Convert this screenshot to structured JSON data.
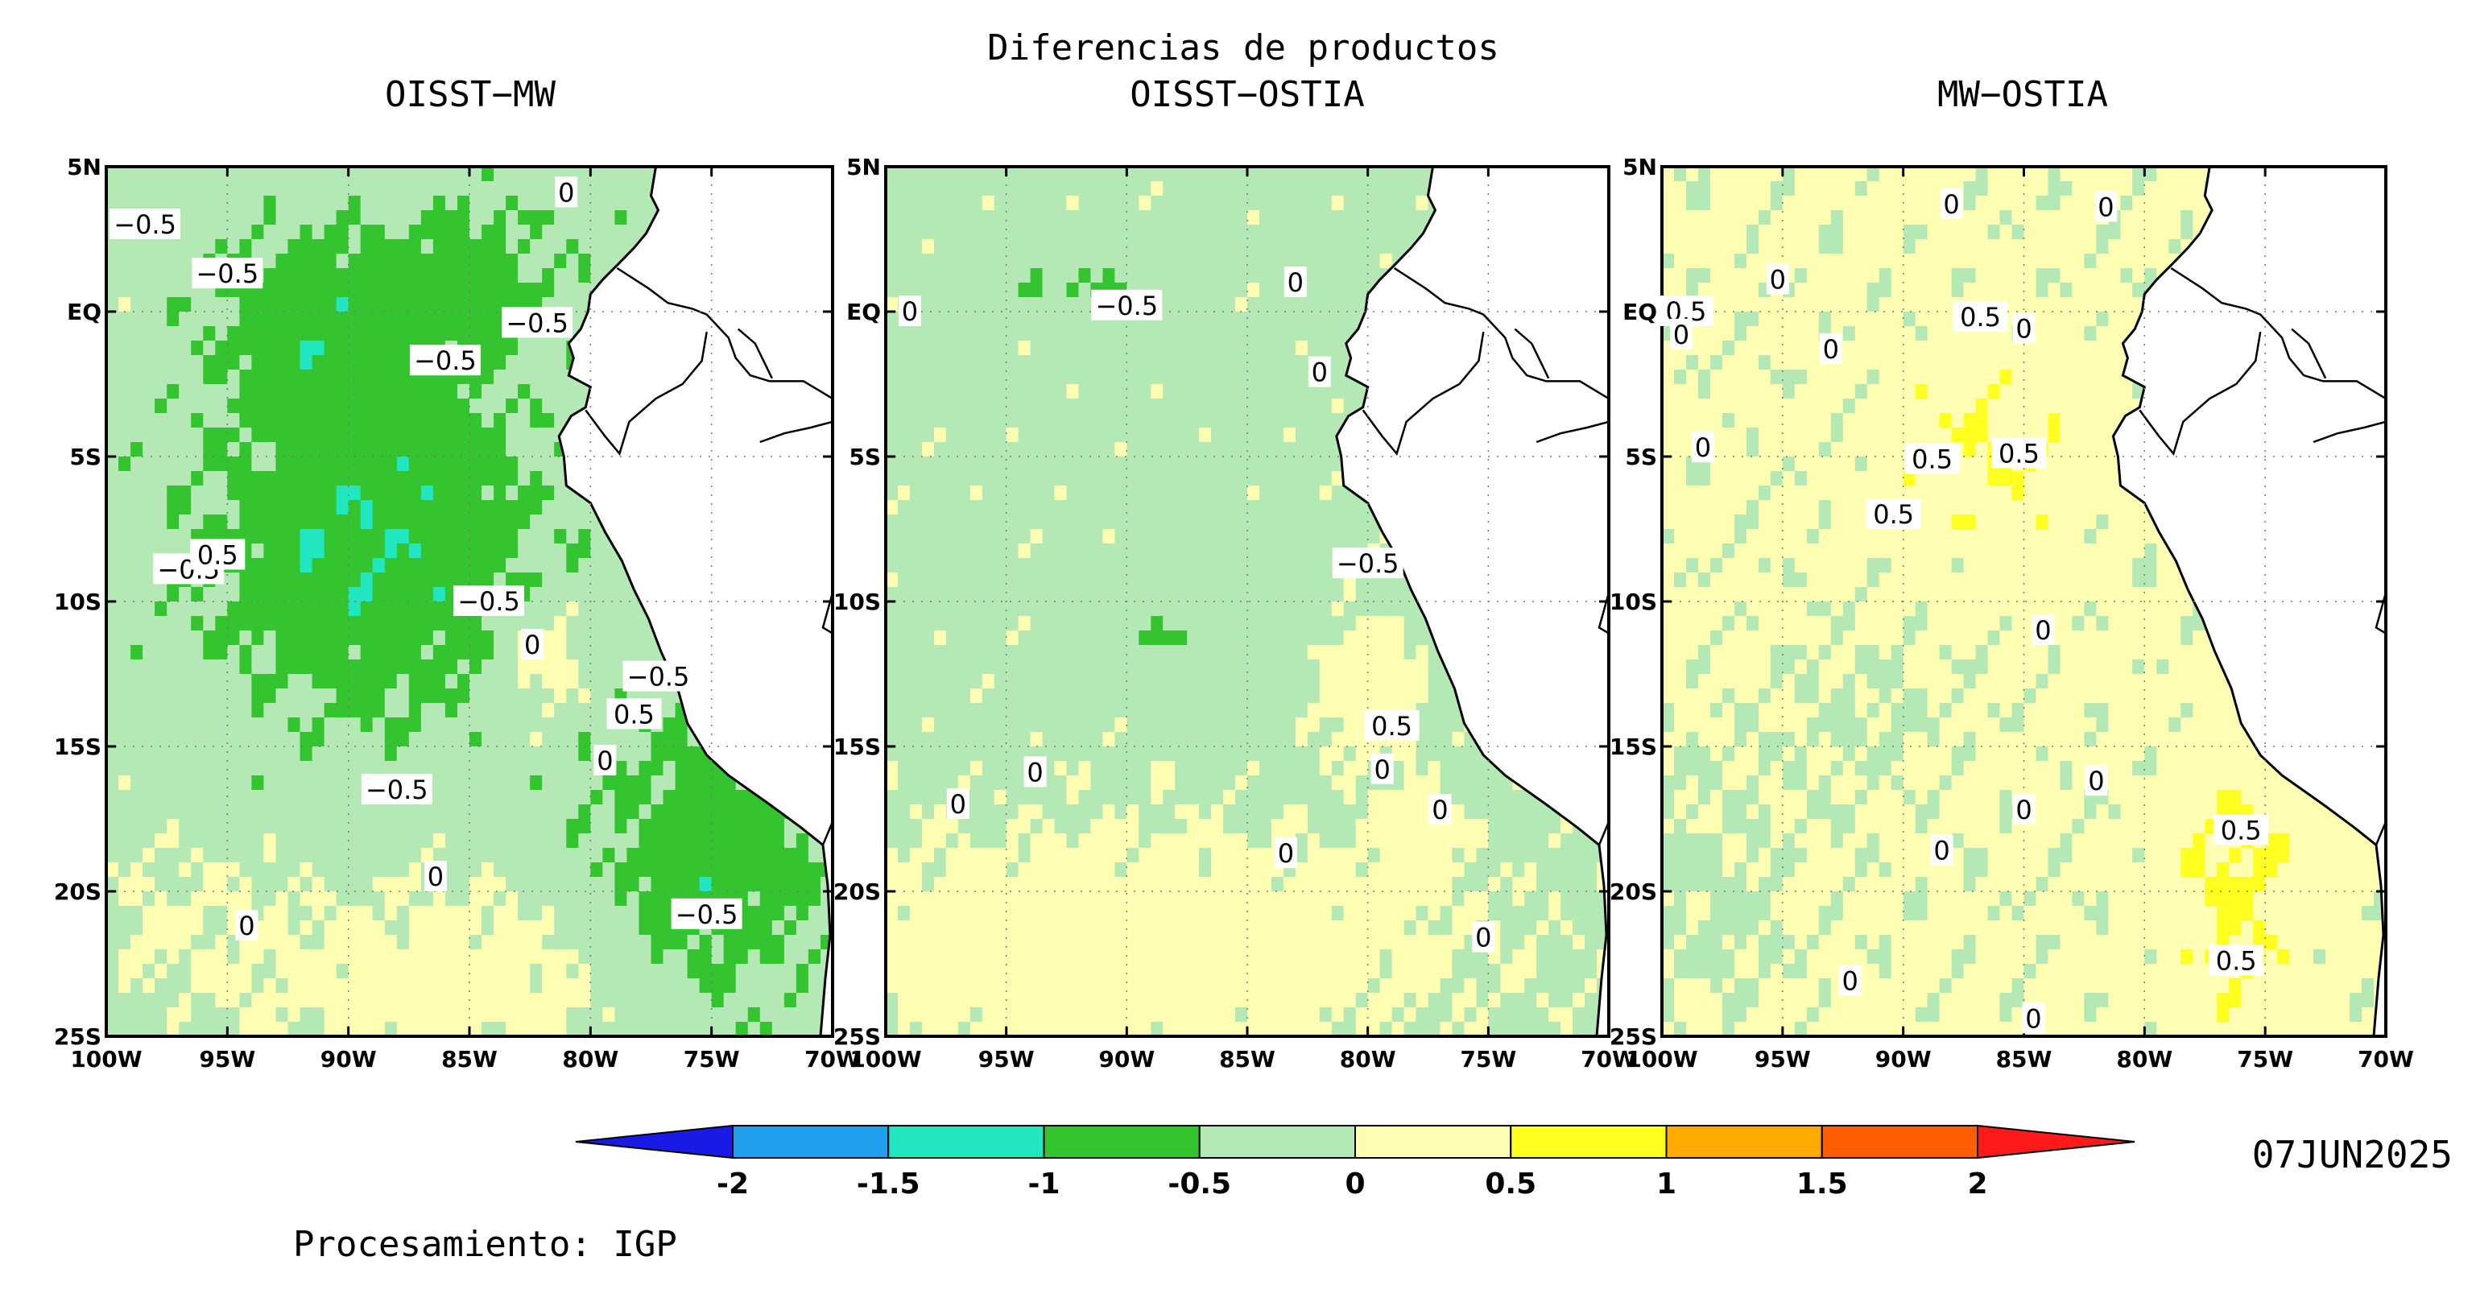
{
  "title": "Diferencias de productos",
  "date": "07JUN2025",
  "credit": "Procesamiento: IGP",
  "x_ticks": [
    "100W",
    "95W",
    "90W",
    "85W",
    "80W",
    "75W",
    "70W"
  ],
  "y_ticks": [
    "5N",
    "EQ",
    "5S",
    "10S",
    "15S",
    "20S",
    "25S"
  ],
  "colorbar": {
    "ticks": [
      "-2",
      "-1.5",
      "-1",
      "-0.5",
      "0",
      "0.5",
      "1",
      "1.5",
      "2"
    ],
    "colors": {
      "below": "#1a1ae6",
      "bins": [
        "#1f9fee",
        "#22e6c0",
        "#33c430",
        "#b4e8b4",
        "#ffffb4",
        "#ffff22",
        "#ffaa00",
        "#ff5f00"
      ],
      "above": "#ff1a1a"
    }
  },
  "colors": {
    "land": "#ffffff",
    "coast": "#000000",
    "contour": "#000000"
  },
  "panels": [
    {
      "title": "OISST−MW",
      "labels": [
        {
          "text": "−0.5",
          "lon": -98.4,
          "lat": 3.0
        },
        {
          "text": "−0.5",
          "lon": -95.0,
          "lat": 1.3
        },
        {
          "text": "−0.5",
          "lon": -82.2,
          "lat": -0.4
        },
        {
          "text": "−0.5",
          "lon": -86.0,
          "lat": -1.7
        },
        {
          "text": "0",
          "lon": -81.0,
          "lat": 4.1
        },
        {
          "text": "−0.5",
          "lon": -96.6,
          "lat": -8.9
        },
        {
          "text": "0.5",
          "lon": -95.4,
          "lat": -8.4
        },
        {
          "text": "−0.5",
          "lon": -84.2,
          "lat": -10.0
        },
        {
          "text": "0",
          "lon": -82.4,
          "lat": -11.5
        },
        {
          "text": "−0.5",
          "lon": -77.2,
          "lat": -12.6
        },
        {
          "text": "0.5",
          "lon": -78.2,
          "lat": -13.9
        },
        {
          "text": "0",
          "lon": -79.4,
          "lat": -15.5
        },
        {
          "text": "−0.5",
          "lon": -88.0,
          "lat": -16.5
        },
        {
          "text": "0",
          "lon": -86.4,
          "lat": -19.5
        },
        {
          "text": "0",
          "lon": -94.2,
          "lat": -21.2
        },
        {
          "text": "−0.5",
          "lon": -75.2,
          "lat": -20.8
        }
      ]
    },
    {
      "title": "OISST−OSTIA",
      "labels": [
        {
          "text": "−0.5",
          "lon": -90.0,
          "lat": 0.2
        },
        {
          "text": "0",
          "lon": -99.0,
          "lat": 0.0
        },
        {
          "text": "0",
          "lon": -83.0,
          "lat": 1.0
        },
        {
          "text": "0",
          "lon": -82.0,
          "lat": -2.1
        },
        {
          "text": "−0.5",
          "lon": -80.0,
          "lat": -8.7
        },
        {
          "text": "0.5",
          "lon": -79.0,
          "lat": -14.3
        },
        {
          "text": "0",
          "lon": -79.4,
          "lat": -15.8
        },
        {
          "text": "0",
          "lon": -77.0,
          "lat": -17.2
        },
        {
          "text": "0",
          "lon": -97.0,
          "lat": -17.0
        },
        {
          "text": "0",
          "lon": -93.8,
          "lat": -15.9
        },
        {
          "text": "0",
          "lon": -83.4,
          "lat": -18.7
        },
        {
          "text": "0",
          "lon": -75.2,
          "lat": -21.6
        }
      ]
    },
    {
      "title": "MW−OSTIA",
      "labels": [
        {
          "text": "0",
          "lon": -88.0,
          "lat": 3.7
        },
        {
          "text": "0",
          "lon": -81.6,
          "lat": 3.6
        },
        {
          "text": "0.5",
          "lon": -99.0,
          "lat": 0.0
        },
        {
          "text": "0",
          "lon": -99.2,
          "lat": -0.8
        },
        {
          "text": "0",
          "lon": -95.2,
          "lat": 1.1
        },
        {
          "text": "0.5",
          "lon": -86.8,
          "lat": -0.2
        },
        {
          "text": "0",
          "lon": -85.0,
          "lat": -0.6
        },
        {
          "text": "0",
          "lon": -93.0,
          "lat": -1.3
        },
        {
          "text": "0",
          "lon": -98.3,
          "lat": -4.7
        },
        {
          "text": "0.5",
          "lon": -88.8,
          "lat": -5.1
        },
        {
          "text": "0.5",
          "lon": -85.2,
          "lat": -4.9
        },
        {
          "text": "0.5",
          "lon": -90.4,
          "lat": -7.0
        },
        {
          "text": "0",
          "lon": -84.2,
          "lat": -11.0
        },
        {
          "text": "0",
          "lon": -82.0,
          "lat": -16.2
        },
        {
          "text": "0",
          "lon": -85.0,
          "lat": -17.2
        },
        {
          "text": "0",
          "lon": -88.4,
          "lat": -18.6
        },
        {
          "text": "0.5",
          "lon": -76.0,
          "lat": -17.9
        },
        {
          "text": "0.5",
          "lon": -76.2,
          "lat": -22.4
        },
        {
          "text": "0",
          "lon": -92.2,
          "lat": -23.1
        },
        {
          "text": "0",
          "lon": -84.6,
          "lat": -24.4
        }
      ]
    }
  ]
}
